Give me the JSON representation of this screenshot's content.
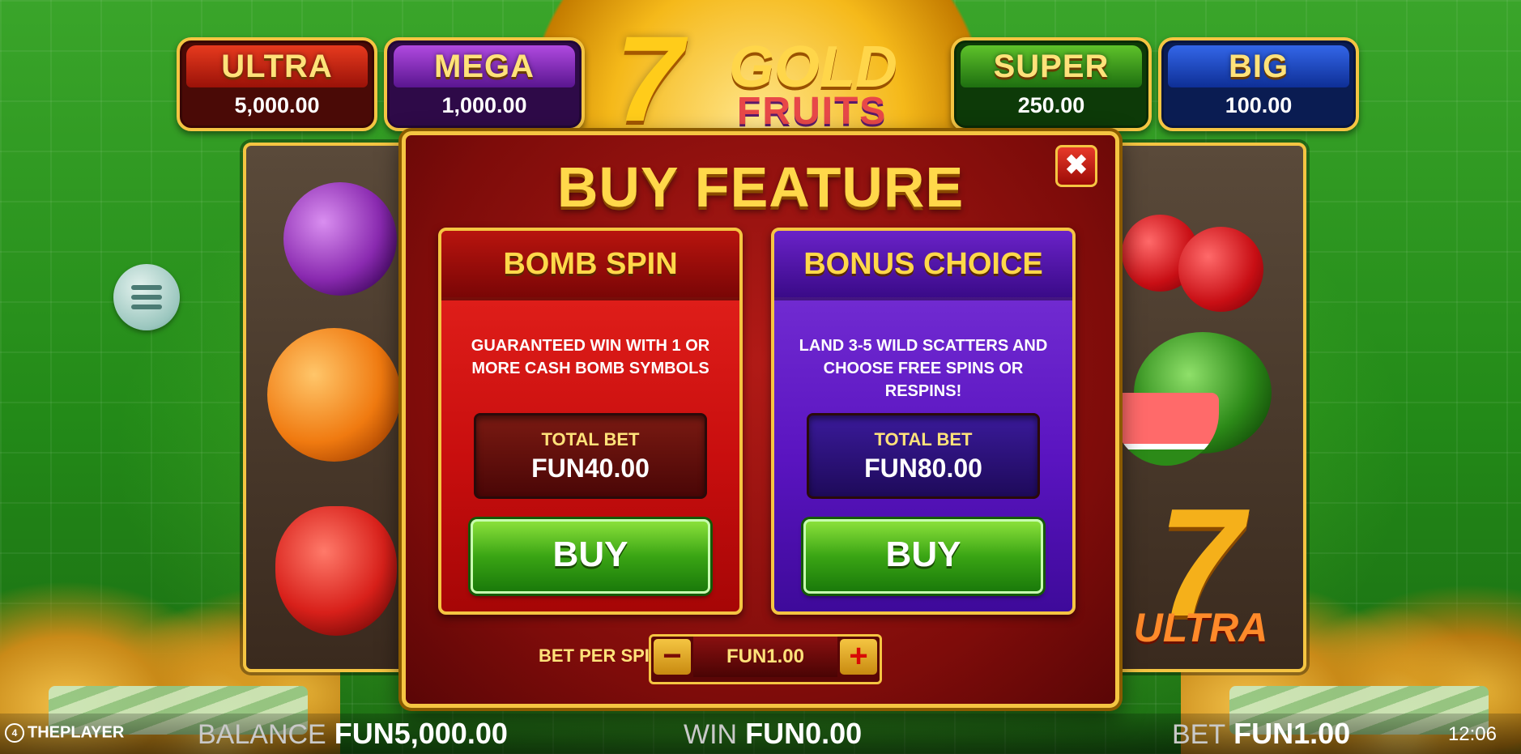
{
  "jackpots": [
    {
      "label": "ULTRA",
      "value": "5,000.00"
    },
    {
      "label": "MEGA",
      "value": "1,000.00"
    },
    {
      "label": "SUPER",
      "value": "250.00"
    },
    {
      "label": "BIG",
      "value": "100.00"
    }
  ],
  "logo": {
    "seven": "7",
    "gold": "GOLD",
    "fruits": "FRUITS"
  },
  "reel_symbols": {
    "seven_ultra_digit": "7",
    "seven_ultra_label": "ULTRA"
  },
  "modal": {
    "title": "BUY FEATURE",
    "close_glyph": "✖",
    "options": [
      {
        "title": "BOMB SPIN",
        "description": "GUARANTEED WIN WITH 1 OR MORE CASH BOMB SYMBOLS",
        "total_bet_label": "TOTAL BET",
        "total_bet_value": "FUN40.00",
        "buy_label": "BUY",
        "color": "#d8150f"
      },
      {
        "title": "BONUS CHOICE",
        "description": "LAND 3-5 WILD SCATTERS AND CHOOSE FREE SPINS OR RESPINS!",
        "total_bet_label": "TOTAL BET",
        "total_bet_value": "FUN80.00",
        "buy_label": "BUY",
        "color": "#5a14c0"
      }
    ],
    "bet_per_spin_label": "BET PER SPIN",
    "bet_per_spin_value": "FUN1.00",
    "minus_glyph": "−",
    "plus_glyph": "+"
  },
  "bottom_bar": {
    "brand": "THEPLAYER",
    "brand_glyph": "4",
    "balance_label": "BALANCE",
    "balance_value": "FUN5,000.00",
    "win_label": "WIN",
    "win_value": "FUN0.00",
    "bet_label": "BET",
    "bet_value": "FUN1.00",
    "clock": "12:06"
  },
  "icons": {
    "menu": "hamburger-menu-icon",
    "close": "close-icon",
    "minus": "minus-icon",
    "plus": "plus-icon"
  }
}
